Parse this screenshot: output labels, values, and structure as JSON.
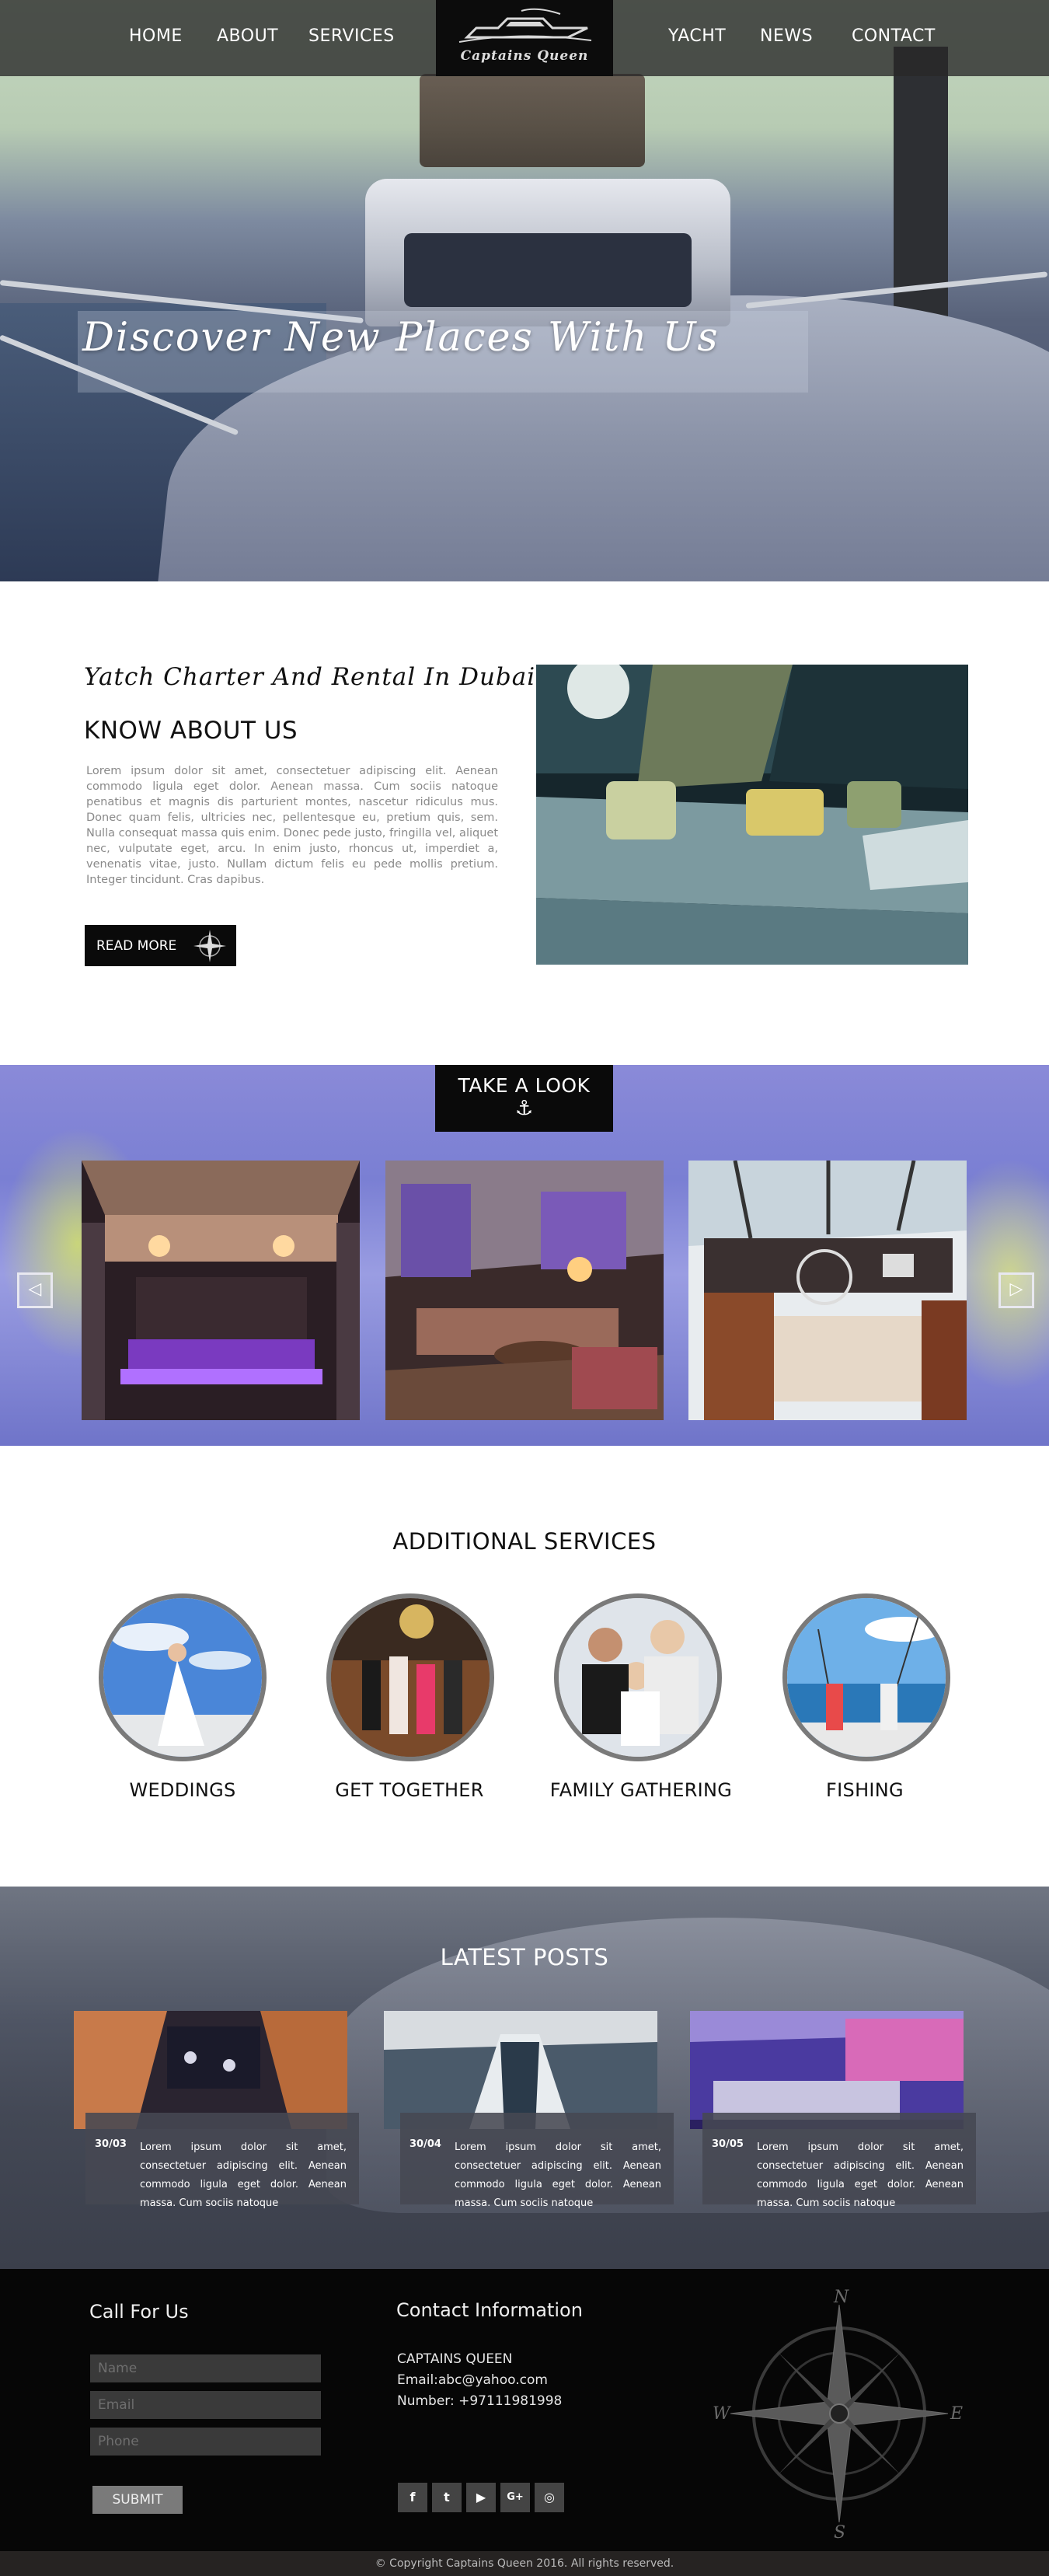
{
  "nav": {
    "left_items": [
      "HOME",
      "ABOUT",
      "SERVICES"
    ],
    "right_items": [
      "YACHT",
      "NEWS",
      "CONTACT"
    ],
    "logo_text": "Captains Queen"
  },
  "hero": {
    "title": "Discover New Places With Us"
  },
  "about": {
    "subtitle": "Yatch Charter And Rental In Dubai",
    "title": "KNOW ABOUT US",
    "body": "Lorem ipsum dolor sit amet, consectetuer adipiscing elit. Aenean commodo ligula eget dolor. Aenean massa. Cum sociis natoque penatibus et magnis dis parturient montes, nascetur ridiculus mus. Donec quam felis, ultricies nec, pellentesque eu, pretium quis, sem. Nulla consequat massa quis enim. Donec pede justo, fringilla vel, aliquet nec, vulputate eget, arcu. In enim justo, rhoncus ut, imperdiet a, venenatis vitae, justo. Nullam dictum felis eu pede mollis pretium. Integer tincidunt. Cras dapibus.",
    "button": "READ MORE"
  },
  "gallery": {
    "title": "TAKE A LOOK",
    "anchor_icon": "⚓",
    "prev_icon": "◁",
    "next_icon": "▷"
  },
  "services": {
    "title": "ADDITIONAL SERVICES",
    "items": [
      "WEDDINGS",
      "GET TOGETHER",
      "FAMILY GATHERING",
      "FISHING"
    ]
  },
  "posts": {
    "title": "LATEST POSTS",
    "items": [
      {
        "date": "30/03",
        "text": "Lorem ipsum dolor sit amet, consectetuer adipiscing elit. Aenean commodo ligula eget dolor. Aenean massa. Cum sociis natoque"
      },
      {
        "date": "30/04",
        "text": "Lorem ipsum dolor sit amet, consectetuer adipiscing elit. Aenean commodo ligula eget dolor. Aenean massa. Cum sociis natoque"
      },
      {
        "date": "30/05",
        "text": "Lorem ipsum dolor sit amet, consectetuer adipiscing elit. Aenean commodo ligula eget dolor. Aenean massa. Cum sociis natoque"
      }
    ]
  },
  "footer": {
    "call_title": "Call For Us",
    "placeholders": [
      "Name",
      "Email",
      "Phone"
    ],
    "submit": "SUBMIT",
    "contact_title": "Contact Information",
    "company": "CAPTAINS QUEEN",
    "email": "Email:abc@yahoo.com",
    "phone": "Number: +97111981998",
    "social": [
      "f",
      "t",
      "▶",
      "G+",
      "◎"
    ],
    "compass_letters": [
      "N",
      "E",
      "S",
      "W"
    ],
    "copyright": "© Copyright Captains Queen 2016. All rights reserved."
  },
  "colors": {
    "nav_bg": "#282828",
    "dark": "#0a0a0a",
    "gallery_bg": "#7a7fd3",
    "footer_bg": "#060606"
  }
}
